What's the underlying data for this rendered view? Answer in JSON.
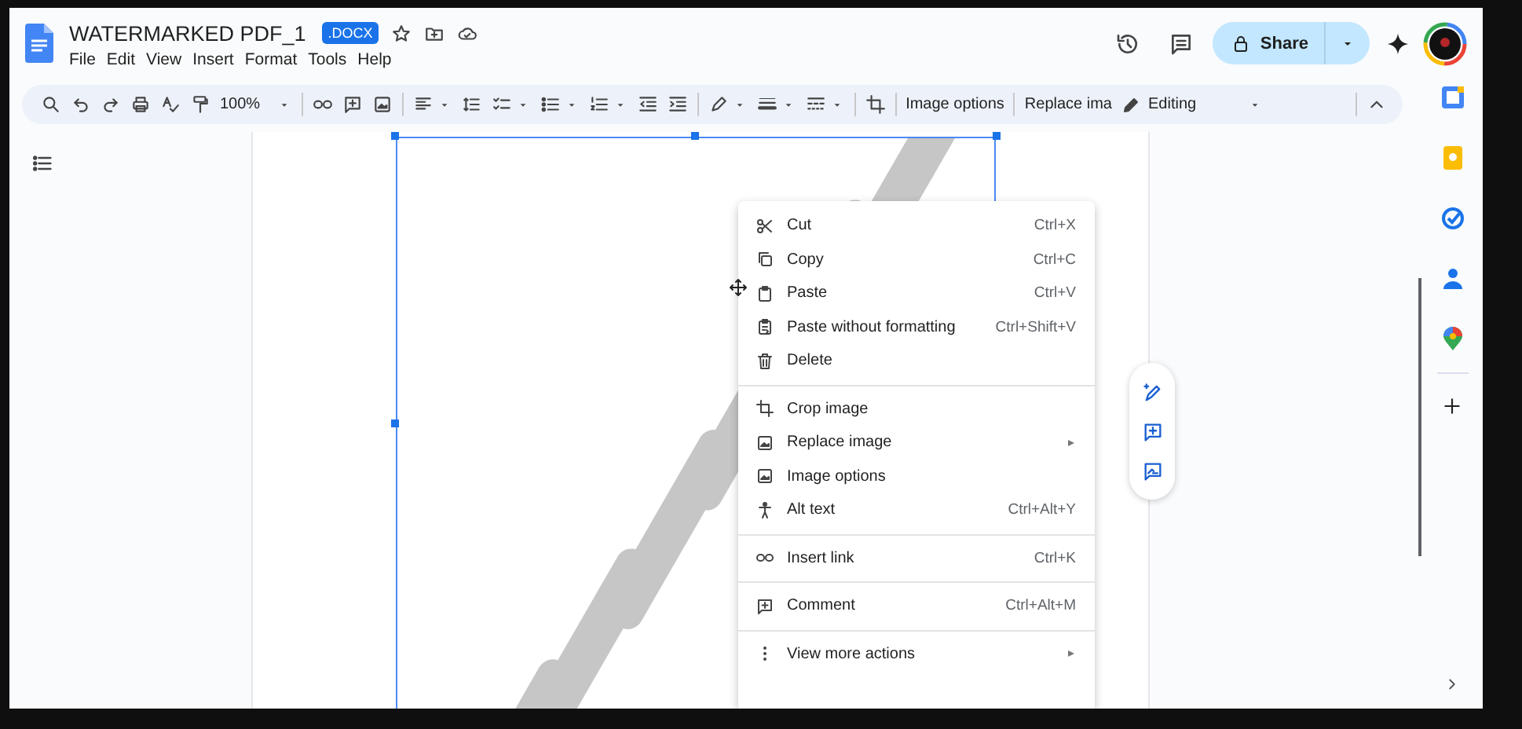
{
  "document": {
    "title": "WATERMARKED PDF_1",
    "badge": ".DOCX"
  },
  "menu_bar": [
    "File",
    "Edit",
    "View",
    "Insert",
    "Format",
    "Tools",
    "Help"
  ],
  "share": {
    "label": "Share"
  },
  "toolbar": {
    "zoom": "100%",
    "text_buttons": [
      "Image options",
      "Replace ima"
    ],
    "mode": "Editing"
  },
  "context_menu": {
    "groups": [
      [
        {
          "label": "Cut",
          "shortcut": "Ctrl+X",
          "kind": "action"
        },
        {
          "label": "Copy",
          "shortcut": "Ctrl+C",
          "kind": "action"
        },
        {
          "label": "Paste",
          "shortcut": "Ctrl+V",
          "kind": "action"
        },
        {
          "label": "Paste without formatting",
          "shortcut": "Ctrl+Shift+V",
          "kind": "action"
        },
        {
          "label": "Delete",
          "kind": "action"
        }
      ],
      [
        {
          "label": "Crop image",
          "kind": "action"
        },
        {
          "label": "Replace image",
          "kind": "submenu"
        },
        {
          "label": "Image options",
          "kind": "action"
        },
        {
          "label": "Alt text",
          "shortcut": "Ctrl+Alt+Y",
          "kind": "action"
        }
      ],
      [
        {
          "label": "Insert link",
          "shortcut": "Ctrl+K",
          "kind": "action"
        }
      ],
      [
        {
          "label": "Comment",
          "shortcut": "Ctrl+Alt+M",
          "kind": "action"
        }
      ],
      [
        {
          "label": "View more actions",
          "kind": "submenu"
        }
      ]
    ]
  }
}
